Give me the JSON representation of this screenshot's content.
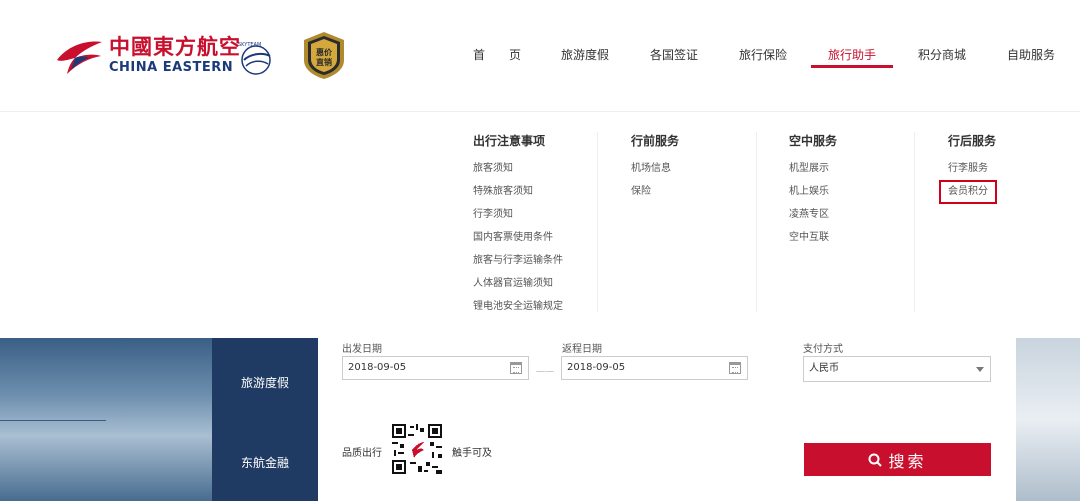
{
  "brand": {
    "name_cn": "中國東方航空",
    "name_en": "CHINA EASTERN",
    "skyteam": "SKYTEAM",
    "badge_text": "惠价直销",
    "accent": "#c8102e",
    "navy": "#1a3a7a"
  },
  "nav": {
    "items": [
      {
        "label": "首　　页"
      },
      {
        "label": "旅游度假"
      },
      {
        "label": "各国签证"
      },
      {
        "label": "旅行保险"
      },
      {
        "label": "旅行助手"
      },
      {
        "label": "积分商城"
      },
      {
        "label": "自助服务"
      }
    ],
    "active": "旅行助手"
  },
  "dropdown": {
    "columns": [
      {
        "title": "出行注意事项",
        "items": [
          "旅客须知",
          "特殊旅客须知",
          "行李须知",
          "国内客票使用条件",
          "旅客与行李运输条件",
          "人体器官运输须知",
          "锂电池安全运输规定"
        ]
      },
      {
        "title": "行前服务",
        "items": [
          "机场信息",
          "保险"
        ]
      },
      {
        "title": "空中服务",
        "items": [
          "机型展示",
          "机上娱乐",
          "凌燕专区",
          "空中互联"
        ]
      },
      {
        "title": "行后服务",
        "items": [
          "行李服务",
          "会员积分"
        ]
      }
    ]
  },
  "side_tabs": [
    "旅游度假",
    "东航金融"
  ],
  "search_form": {
    "depart_label": "出发日期",
    "depart_value": "2018-09-05",
    "return_label": "返程日期",
    "return_value": "2018-09-05",
    "date_separator": "一一",
    "payment_label": "支付方式",
    "payment_value": "人民币",
    "qr_left_text": "品质出行",
    "qr_right_text": "触手可及",
    "search_button": "搜索"
  }
}
